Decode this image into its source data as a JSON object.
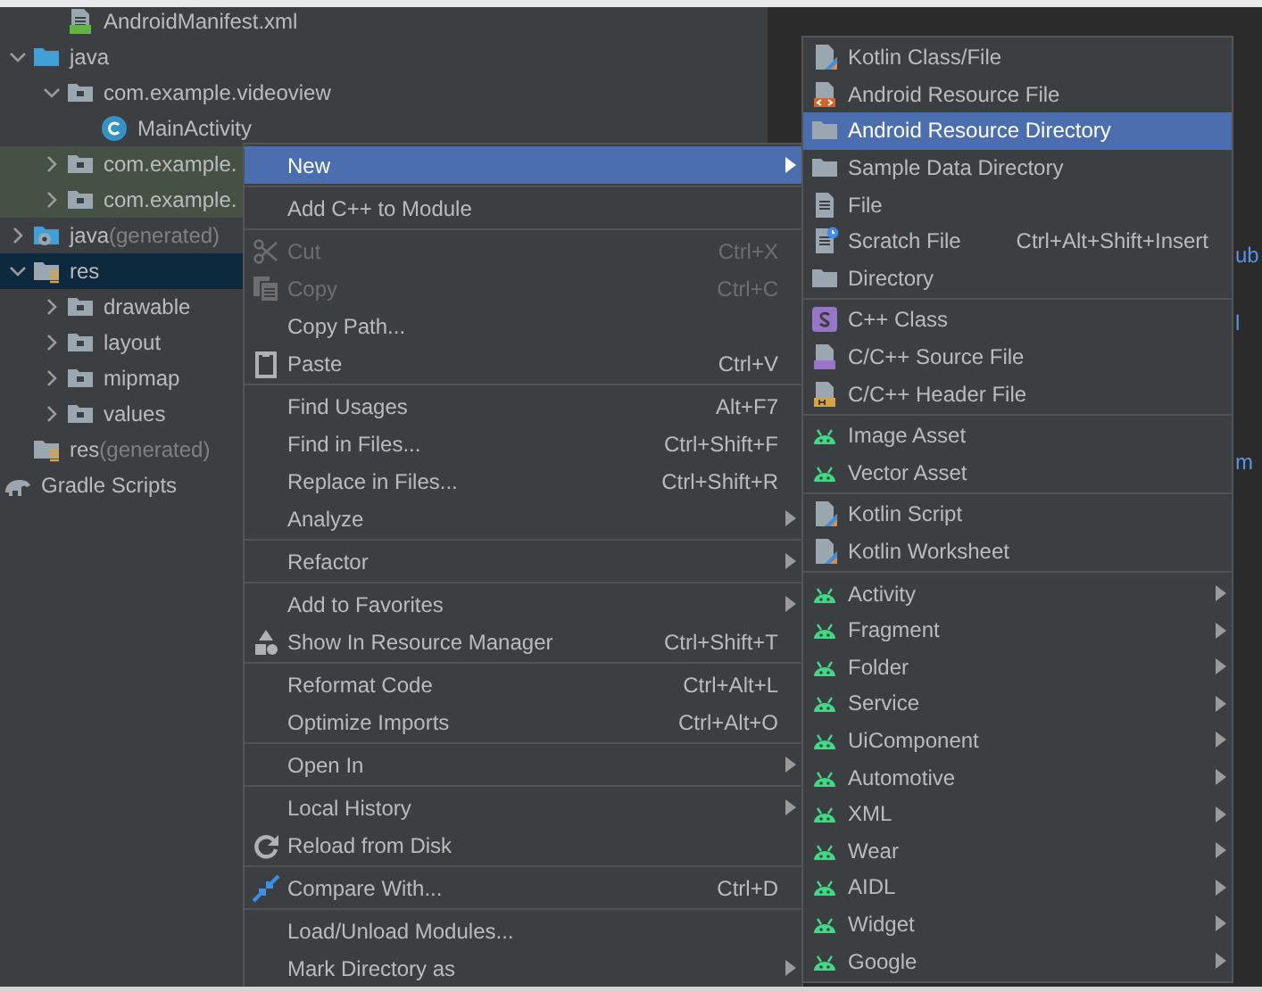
{
  "project_tree": {
    "items": [
      {
        "children": [
          {
            "label": "AndroidManifest.xml",
            "kind": "manifest",
            "selected": false,
            "highlighted": false
          }
        ]
      },
      {
        "label": "java",
        "kind": "source-folder",
        "expanded": true,
        "selected": false,
        "highlighted": false,
        "children": [
          {
            "label": "com.example.videoview",
            "kind": "package",
            "expanded": true,
            "selected": false,
            "highlighted": false,
            "children": [
              {
                "label": "MainActivity",
                "kind": "class",
                "selected": false,
                "highlighted": false
              }
            ]
          },
          {
            "label": "com.example.",
            "kind": "package",
            "expanded": false,
            "selected": false,
            "highlighted": true
          },
          {
            "label": "com.example.",
            "kind": "package",
            "expanded": false,
            "selected": false,
            "highlighted": true
          }
        ]
      },
      {
        "label": "java",
        "note": "(generated)",
        "kind": "generated-folder",
        "expanded": false,
        "selected": false,
        "highlighted": false
      },
      {
        "label": "res",
        "kind": "res-folder",
        "expanded": true,
        "selected": true,
        "highlighted": false,
        "children": [
          {
            "label": "drawable",
            "kind": "package",
            "expanded": false,
            "selected": false,
            "highlighted": false
          },
          {
            "label": "layout",
            "kind": "package",
            "expanded": false,
            "selected": false,
            "highlighted": false
          },
          {
            "label": "mipmap",
            "kind": "package",
            "expanded": false,
            "selected": false,
            "highlighted": false
          },
          {
            "label": "values",
            "kind": "package",
            "expanded": false,
            "selected": false,
            "highlighted": false
          }
        ]
      },
      {
        "label": "res",
        "note": "(generated)",
        "kind": "res-folder",
        "selected": false,
        "highlighted": false
      },
      {
        "label": "Gradle Scripts",
        "kind": "gradle",
        "selected": false,
        "highlighted": false
      }
    ]
  },
  "editor": {
    "fragments": [
      "ub",
      "l",
      "m"
    ]
  },
  "context_menu": {
    "items": [
      {
        "kind": "plain",
        "label": "New",
        "submenu": true,
        "selected": true,
        "disabled": false
      },
      {
        "kind": "separator"
      },
      {
        "kind": "plain",
        "label": "Add C++ to Module",
        "submenu": false,
        "selected": false,
        "disabled": false
      },
      {
        "kind": "separator"
      },
      {
        "kind": "scissors",
        "label": "Cut",
        "shortcut": "Ctrl+X",
        "submenu": false,
        "selected": false,
        "disabled": true
      },
      {
        "kind": "copy",
        "label": "Copy",
        "shortcut": "Ctrl+C",
        "submenu": false,
        "selected": false,
        "disabled": true
      },
      {
        "kind": "plain",
        "label": "Copy Path...",
        "submenu": false,
        "selected": false,
        "disabled": false
      },
      {
        "kind": "clipboard",
        "label": "Paste",
        "shortcut": "Ctrl+V",
        "submenu": false,
        "selected": false,
        "disabled": false
      },
      {
        "kind": "separator"
      },
      {
        "kind": "plain",
        "label": "Find Usages",
        "shortcut": "Alt+F7",
        "submenu": false,
        "selected": false,
        "disabled": false
      },
      {
        "kind": "plain",
        "label": "Find in Files...",
        "shortcut": "Ctrl+Shift+F",
        "submenu": false,
        "selected": false,
        "disabled": false
      },
      {
        "kind": "plain",
        "label": "Replace in Files...",
        "shortcut": "Ctrl+Shift+R",
        "submenu": false,
        "selected": false,
        "disabled": false
      },
      {
        "kind": "plain",
        "label": "Analyze",
        "submenu": true,
        "selected": false,
        "disabled": false
      },
      {
        "kind": "separator"
      },
      {
        "kind": "plain",
        "label": "Refactor",
        "submenu": true,
        "selected": false,
        "disabled": false
      },
      {
        "kind": "separator"
      },
      {
        "kind": "plain",
        "label": "Add to Favorites",
        "submenu": true,
        "selected": false,
        "disabled": false
      },
      {
        "kind": "shapes",
        "label": "Show In Resource Manager",
        "shortcut": "Ctrl+Shift+T",
        "submenu": false,
        "selected": false,
        "disabled": false
      },
      {
        "kind": "separator"
      },
      {
        "kind": "plain",
        "label": "Reformat Code",
        "shortcut": "Ctrl+Alt+L",
        "submenu": false,
        "selected": false,
        "disabled": false
      },
      {
        "kind": "plain",
        "label": "Optimize Imports",
        "shortcut": "Ctrl+Alt+O",
        "submenu": false,
        "selected": false,
        "disabled": false
      },
      {
        "kind": "separator"
      },
      {
        "kind": "plain",
        "label": "Open In",
        "submenu": true,
        "selected": false,
        "disabled": false
      },
      {
        "kind": "separator"
      },
      {
        "kind": "plain",
        "label": "Local History",
        "submenu": true,
        "selected": false,
        "disabled": false
      },
      {
        "kind": "reload",
        "label": "Reload from Disk",
        "submenu": false,
        "selected": false,
        "disabled": false
      },
      {
        "kind": "separator"
      },
      {
        "kind": "compare",
        "label": "Compare With...",
        "shortcut": "Ctrl+D",
        "submenu": false,
        "selected": false,
        "disabled": false
      },
      {
        "kind": "separator"
      },
      {
        "kind": "plain",
        "label": "Load/Unload Modules...",
        "submenu": false,
        "selected": false,
        "disabled": false
      },
      {
        "kind": "plain",
        "label": "Mark Directory as",
        "submenu": true,
        "selected": false,
        "disabled": false
      }
    ]
  },
  "new_submenu": {
    "items": [
      {
        "kind": "kotlin",
        "label": "Kotlin Class/File",
        "submenu": false,
        "selected": false
      },
      {
        "kind": "resource-file",
        "label": "Android Resource File",
        "submenu": false,
        "selected": false
      },
      {
        "kind": "folder",
        "label": "Android Resource Directory",
        "submenu": false,
        "selected": true
      },
      {
        "kind": "folder",
        "label": "Sample Data Directory",
        "submenu": false,
        "selected": false
      },
      {
        "kind": "file",
        "label": "File",
        "submenu": false,
        "selected": false
      },
      {
        "kind": "scratch",
        "label": "Scratch File",
        "shortcut": "Ctrl+Alt+Shift+Insert",
        "submenu": false,
        "selected": false
      },
      {
        "kind": "folder",
        "label": "Directory",
        "submenu": false,
        "selected": false
      },
      {
        "kind": "separator"
      },
      {
        "kind": "cpp-class",
        "label": "C++ Class",
        "submenu": false,
        "selected": false
      },
      {
        "kind": "cpp-source",
        "label": "C/C++ Source File",
        "submenu": false,
        "selected": false
      },
      {
        "kind": "cpp-header",
        "label": "C/C++ Header File",
        "submenu": false,
        "selected": false
      },
      {
        "kind": "separator"
      },
      {
        "kind": "android",
        "label": "Image Asset",
        "submenu": false,
        "selected": false
      },
      {
        "kind": "android",
        "label": "Vector Asset",
        "submenu": false,
        "selected": false
      },
      {
        "kind": "separator"
      },
      {
        "kind": "kotlin",
        "label": "Kotlin Script",
        "submenu": false,
        "selected": false
      },
      {
        "kind": "kotlin",
        "label": "Kotlin Worksheet",
        "submenu": false,
        "selected": false
      },
      {
        "kind": "separator"
      },
      {
        "kind": "android",
        "label": "Activity",
        "submenu": true,
        "selected": false
      },
      {
        "kind": "android",
        "label": "Fragment",
        "submenu": true,
        "selected": false
      },
      {
        "kind": "android",
        "label": "Folder",
        "submenu": true,
        "selected": false
      },
      {
        "kind": "android",
        "label": "Service",
        "submenu": true,
        "selected": false
      },
      {
        "kind": "android",
        "label": "UiComponent",
        "submenu": true,
        "selected": false
      },
      {
        "kind": "android",
        "label": "Automotive",
        "submenu": true,
        "selected": false
      },
      {
        "kind": "android",
        "label": "XML",
        "submenu": true,
        "selected": false
      },
      {
        "kind": "android",
        "label": "Wear",
        "submenu": true,
        "selected": false
      },
      {
        "kind": "android",
        "label": "AIDL",
        "submenu": true,
        "selected": false
      },
      {
        "kind": "android",
        "label": "Widget",
        "submenu": true,
        "selected": false
      },
      {
        "kind": "android",
        "label": "Google",
        "submenu": true,
        "selected": false
      }
    ]
  }
}
